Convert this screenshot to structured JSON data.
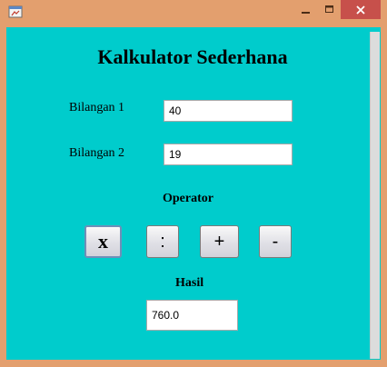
{
  "window": {
    "controls": {
      "minimize_icon": "minimize-icon",
      "maximize_icon": "maximize-icon",
      "close_icon": "close-icon"
    },
    "accent": "#E39F6E",
    "close_color": "#C7504B"
  },
  "form": {
    "background": "#00CCCC",
    "title": "Kalkulator Sederhana",
    "bilangan1": {
      "label": "Bilangan 1",
      "value": "40"
    },
    "bilangan2": {
      "label": "Bilangan 2",
      "value": "19"
    },
    "operator_label": "Operator",
    "operators": [
      {
        "label": "x"
      },
      {
        "label": ":"
      },
      {
        "label": "+"
      },
      {
        "label": "-"
      }
    ],
    "hasil_label": "Hasil",
    "hasil_value": "760.0"
  }
}
